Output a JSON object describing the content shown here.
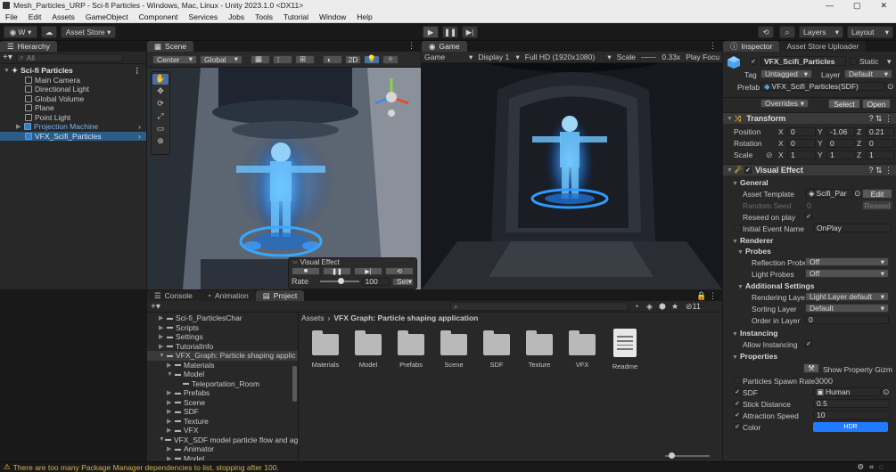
{
  "window": {
    "title": "Mesh_Particles_URP - Sci-fi Particles - Windows, Mac, Linux - Unity 2023.1.0 <DX11>",
    "controls": [
      "—",
      "▢",
      "✕"
    ]
  },
  "menu": [
    "File",
    "Edit",
    "Assets",
    "GameObject",
    "Component",
    "Services",
    "Jobs",
    "Tools",
    "Tutorial",
    "Window",
    "Help"
  ],
  "toolbar": {
    "account": "W",
    "asset_store": "Asset Store",
    "layers": "Layers",
    "layout": "Layout"
  },
  "hierarchy": {
    "tab": "Hierarchy",
    "search_placeholder": "All",
    "scene": "Sci-fi Particles",
    "items": [
      "Main Camera",
      "Directional Light",
      "Global Volume",
      "Plane",
      "Point Light",
      "Projection Machine",
      "VFX_Scifi_Particles"
    ]
  },
  "scene_view": {
    "tab": "Scene",
    "pivot": "Center",
    "space": "Global",
    "mode_2d": "2D",
    "overlay": {
      "title": "Visual Effect",
      "rate_label": "Rate",
      "rate_value": "100",
      "set_label": "Set"
    }
  },
  "game_view": {
    "tab": "Game",
    "display_mode": "Game",
    "display": "Display 1",
    "resolution": "Full HD (1920x1080)",
    "scale_label": "Scale",
    "scale_value": "0.33x",
    "play_focus": "Play Focu"
  },
  "bottom_tabs": [
    "Console",
    "Animation",
    "Project"
  ],
  "project": {
    "tree": [
      {
        "label": "Sci-fi_ParticlesChar",
        "indent": 1
      },
      {
        "label": "Scripts",
        "indent": 1
      },
      {
        "label": "Settings",
        "indent": 1
      },
      {
        "label": "TutorialInfo",
        "indent": 1
      },
      {
        "label": "VFX_Graph:  Particle shaping applic",
        "indent": 1,
        "open": true
      },
      {
        "label": "Materials",
        "indent": 2
      },
      {
        "label": "Model",
        "indent": 2,
        "open": true
      },
      {
        "label": "Teleportation_Room",
        "indent": 3
      },
      {
        "label": "Prefabs",
        "indent": 2
      },
      {
        "label": "Scene",
        "indent": 2
      },
      {
        "label": "SDF",
        "indent": 2
      },
      {
        "label": "Texture",
        "indent": 2
      },
      {
        "label": "VFX",
        "indent": 2
      },
      {
        "label": "VFX_SDF model particle flow and ag",
        "indent": 1,
        "open": true
      },
      {
        "label": "Animator",
        "indent": 2
      },
      {
        "label": "Model",
        "indent": 2
      }
    ],
    "breadcrumb": [
      "Assets",
      "VFX Graph:  Particle shaping application"
    ],
    "assets": [
      "Materials",
      "Model",
      "Prefabs",
      "Scene",
      "SDF",
      "Texture",
      "VFX",
      "Readme"
    ],
    "hidden_count": "11"
  },
  "inspector": {
    "tabs": [
      "Inspector",
      "Asset Store Uploader"
    ],
    "object_name": "VFX_Scifi_Particles",
    "static_label": "Static",
    "tag_label": "Tag",
    "tag_value": "Untagged",
    "layer_label": "Layer",
    "layer_value": "Default",
    "prefab_label": "Prefab",
    "prefab_value": "VFX_Scifi_Particles(SDF)",
    "overrides": "Overrides",
    "select": "Select",
    "open": "Open",
    "transform": {
      "title": "Transform",
      "position": {
        "label": "Position",
        "x": "0",
        "y": "-1.06",
        "z": "0.21"
      },
      "rotation": {
        "label": "Rotation",
        "x": "0",
        "y": "0",
        "z": "0"
      },
      "scale": {
        "label": "Scale",
        "x": "1",
        "y": "1",
        "z": "1"
      }
    },
    "visual_effect": {
      "title": "Visual Effect",
      "general": "General",
      "asset_template_label": "Asset Template",
      "asset_template_value": "Scifi_Par",
      "edit": "Edit",
      "random_seed_label": "Random Seed",
      "random_seed_value": "0",
      "reseed": "Reseed",
      "reseed_on_play": "Reseed on play",
      "initial_event_label": "Initial Event Name",
      "initial_event_value": "OnPlay",
      "renderer": "Renderer",
      "probes": "Probes",
      "reflection_label": "Reflection Probe",
      "reflection_value": "Off",
      "light_probes_label": "Light Probes",
      "light_probes_value": "Off",
      "additional": "Additional Settings",
      "rendering_layer_label": "Rendering Laye",
      "rendering_layer_value": "Light Layer default",
      "sorting_layer_label": "Sorting Layer",
      "sorting_layer_value": "Default",
      "order_label": "Order in Layer",
      "order_value": "0",
      "instancing": "Instancing",
      "allow_instancing": "Allow Instancing",
      "properties": "Properties",
      "show_gizmo": "Show Property Gizm",
      "spawn_label": "Particles Spawn Rate",
      "spawn_value": "3000",
      "sdf_label": "SDF",
      "sdf_value": "Human",
      "stick_label": "Stick Distance",
      "stick_value": "0.5",
      "attraction_label": "Attraction Speed",
      "attraction_value": "10",
      "color_label": "Color",
      "color_hdr": "HDR",
      "color_value": "#1f7bff"
    }
  },
  "status": {
    "message": "There are too many Package Manager dependencies to list, stopping after 100.",
    "warning_color": "#f2c037"
  }
}
